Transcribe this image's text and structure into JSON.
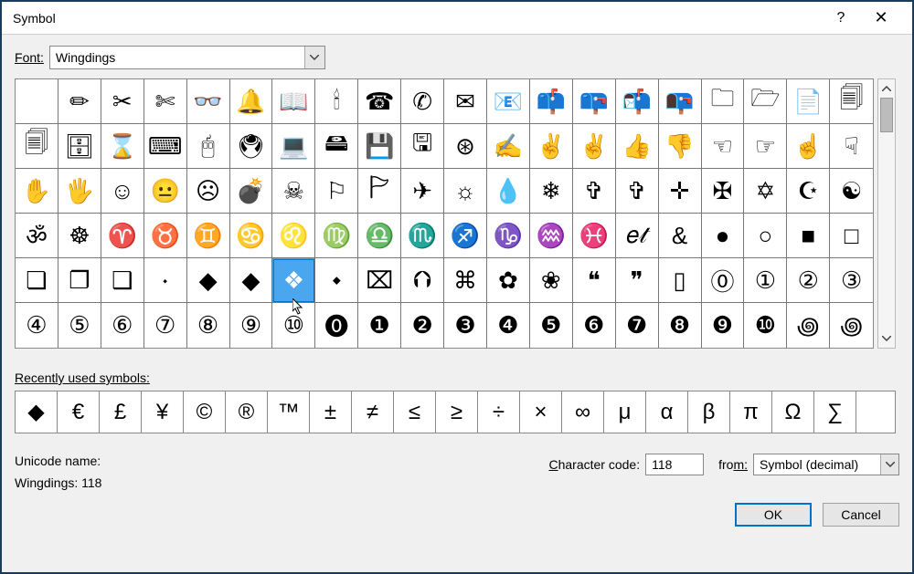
{
  "titlebar": {
    "title": "Symbol",
    "help": "?",
    "close": "✕"
  },
  "font": {
    "label_pre": "F",
    "label_post": "ont:",
    "value": "Wingdings"
  },
  "grid_rows": [
    [
      " ",
      "✏",
      "✂",
      "✄",
      "👓",
      "🔔",
      "📖",
      "🕯",
      "☎",
      "✆",
      "✉",
      "📧",
      "📫",
      "📪",
      "📬",
      "📭",
      "🗀",
      "🗁",
      "📄",
      "🗐"
    ],
    [
      "🗐",
      "🗄",
      "⌛",
      "⌨",
      "🖰",
      "🖲",
      "💻",
      "🖴",
      "💾",
      "🖫",
      "⊛",
      "✍",
      "✌",
      "✌",
      "👍",
      "👎",
      "☜",
      "☞",
      "☝",
      "☟"
    ],
    [
      "✋",
      "🖐",
      "☺",
      "😐",
      "☹",
      "💣",
      "☠",
      "⚐",
      "🏱",
      "✈",
      "☼",
      "💧",
      "❄",
      "✞",
      "✞",
      "✛",
      "✠",
      "✡",
      "☪",
      "☯"
    ],
    [
      "ॐ",
      "☸",
      "♈",
      "♉",
      "♊",
      "♋",
      "♌",
      "♍",
      "♎",
      "♏",
      "♐",
      "♑",
      "♒",
      "♓",
      "𝑒𝓉",
      "&",
      "●",
      "○",
      "■",
      "□"
    ],
    [
      "❏",
      "❐",
      "❑",
      "🞗",
      "◆",
      "◆",
      "❖",
      "⬩",
      "⌧",
      "⮉",
      "⌘",
      "✿",
      "❀",
      "❝",
      "❞",
      "▯",
      "⓪",
      "①",
      "②",
      "③"
    ],
    [
      "④",
      "⑤",
      "⑥",
      "⑦",
      "⑧",
      "⑨",
      "⑩",
      "⓿",
      "❶",
      "❷",
      "❸",
      "❹",
      "❺",
      "❻",
      "❼",
      "❽",
      "❾",
      "❿",
      "꩜",
      "꩜"
    ]
  ],
  "selected": {
    "row": 4,
    "col": 6
  },
  "recent": {
    "label_pre": "R",
    "label_post": "ecently used symbols:",
    "items": [
      "◆",
      "€",
      "£",
      "¥",
      "©",
      "®",
      "™",
      "±",
      "≠",
      "≤",
      "≥",
      "÷",
      "×",
      "∞",
      "μ",
      "α",
      "β",
      "π",
      "Ω",
      "∑"
    ]
  },
  "unicode_label": "Unicode name:",
  "unicode_value": "Wingdings: 118",
  "char_code": {
    "label_pre": "C",
    "label_post": "haracter code:",
    "value": "118"
  },
  "from": {
    "label_pre": "fro",
    "label_post": "m:",
    "value": "Symbol (decimal)"
  },
  "buttons": {
    "ok": "OK",
    "cancel": "Cancel"
  }
}
